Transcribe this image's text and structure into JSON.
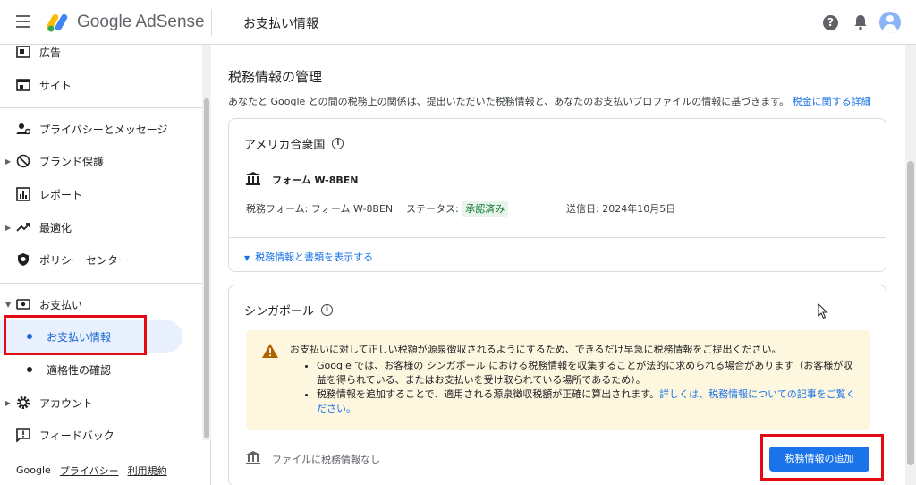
{
  "header": {
    "logo_text": "Google AdSense",
    "page_title": "お支払い情報",
    "help_glyph": "?"
  },
  "sidebar": {
    "items": [
      {
        "label": "広告",
        "icon": "ad-icon"
      },
      {
        "label": "サイト",
        "icon": "site-icon"
      },
      {
        "label": "プライバシーとメッセージ",
        "icon": "privacy-icon"
      },
      {
        "label": "ブランド保護",
        "icon": "block-icon"
      },
      {
        "label": "レポート",
        "icon": "report-icon"
      },
      {
        "label": "最適化",
        "icon": "trend-icon"
      },
      {
        "label": "ポリシー センター",
        "icon": "policy-icon"
      },
      {
        "label": "お支払い",
        "icon": "payment-icon"
      },
      {
        "label": "お支払い情報",
        "icon": "dot"
      },
      {
        "label": "適格性の確認",
        "icon": "dot"
      },
      {
        "label": "アカウント",
        "icon": "gear-icon"
      },
      {
        "label": "フィードバック",
        "icon": "feedback-icon"
      }
    ],
    "footer": {
      "brand": "Google",
      "privacy": "プライバシー",
      "terms": "利用規約"
    }
  },
  "main": {
    "section_title": "税務情報の管理",
    "description": "あなたと Google との間の税務上の関係は、提出いただいた税務情報と、あなたのお支払いプロファイルの情報に基づきます。",
    "description_link": "税金に関する詳細",
    "us_card": {
      "title": "アメリカ合衆国",
      "form_name": "フォーム W-8BEN",
      "tax_form_label": "税務フォーム: フォーム W-8BEN",
      "status_label": "ステータス:",
      "status_value": "承認済み",
      "sent_date": "送信日: 2024年10月5日",
      "expand_link": "税務情報と書類を表示する"
    },
    "sg_card": {
      "title": "シンガポール",
      "warning_main": "お支払いに対して正しい税額が源泉徴収されるようにするため、できるだけ早急に税務情報をご提出ください。",
      "bullet1": "Google では、お客様の シンガポール における税務情報を収集することが法的に求められる場合があります（お客様が収益を得られている、またはお支払いを受け取られている場所であるため）。",
      "bullet2_text": "税務情報を追加することで、適用される源泉徴収税額が正確に算出されます。",
      "bullet2_link": "詳しくは、税務情報についての記事をご覧ください。",
      "no_file": "ファイルに税務情報なし",
      "add_button": "税務情報の追加"
    }
  },
  "colors": {
    "accent": "#1a73e8",
    "highlight_border": "#e50914",
    "warning_bg": "#fef7e0",
    "status_green": "#137333"
  }
}
